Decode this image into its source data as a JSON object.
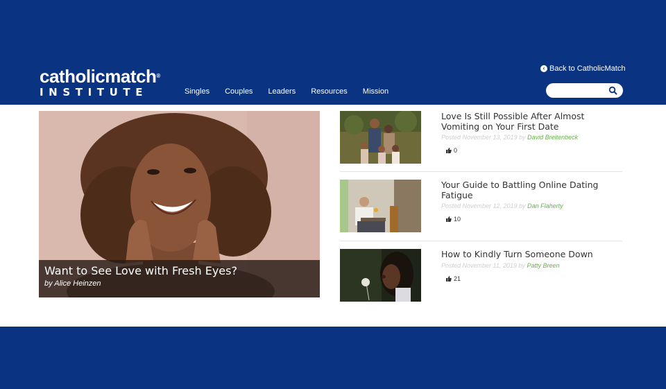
{
  "brand": {
    "logo_top": "catholicmatch",
    "logo_mark": "®",
    "logo_bottom": "INSTITUTE"
  },
  "nav": [
    "Singles",
    "Couples",
    "Leaders",
    "Resources",
    "Mission"
  ],
  "header": {
    "back_link": "Back to CatholicMatch",
    "search_placeholder": ""
  },
  "hero": {
    "title": "Want to See Love with Fresh Eyes?",
    "author": "by Alice Heinzen"
  },
  "articles": [
    {
      "title": "Love Is Still Possible After Almost Vomiting on Your First Date",
      "posted": "Posted November 13, 2019 by",
      "author": "David Breitenbeck",
      "likes": "0"
    },
    {
      "title": "Your Guide to Battling Online Dating Fatigue",
      "posted": "Posted November 12, 2019 by",
      "author": "Dan Flaherty",
      "likes": "10"
    },
    {
      "title": "How to Kindly Turn Someone Down",
      "posted": "Posted November 11, 2019 by",
      "author": "Patty Breen",
      "likes": "21"
    }
  ],
  "colors": {
    "brand_blue": "#0a3382",
    "author_green": "#6ab04c",
    "meta_gray": "#cfcfcf"
  }
}
